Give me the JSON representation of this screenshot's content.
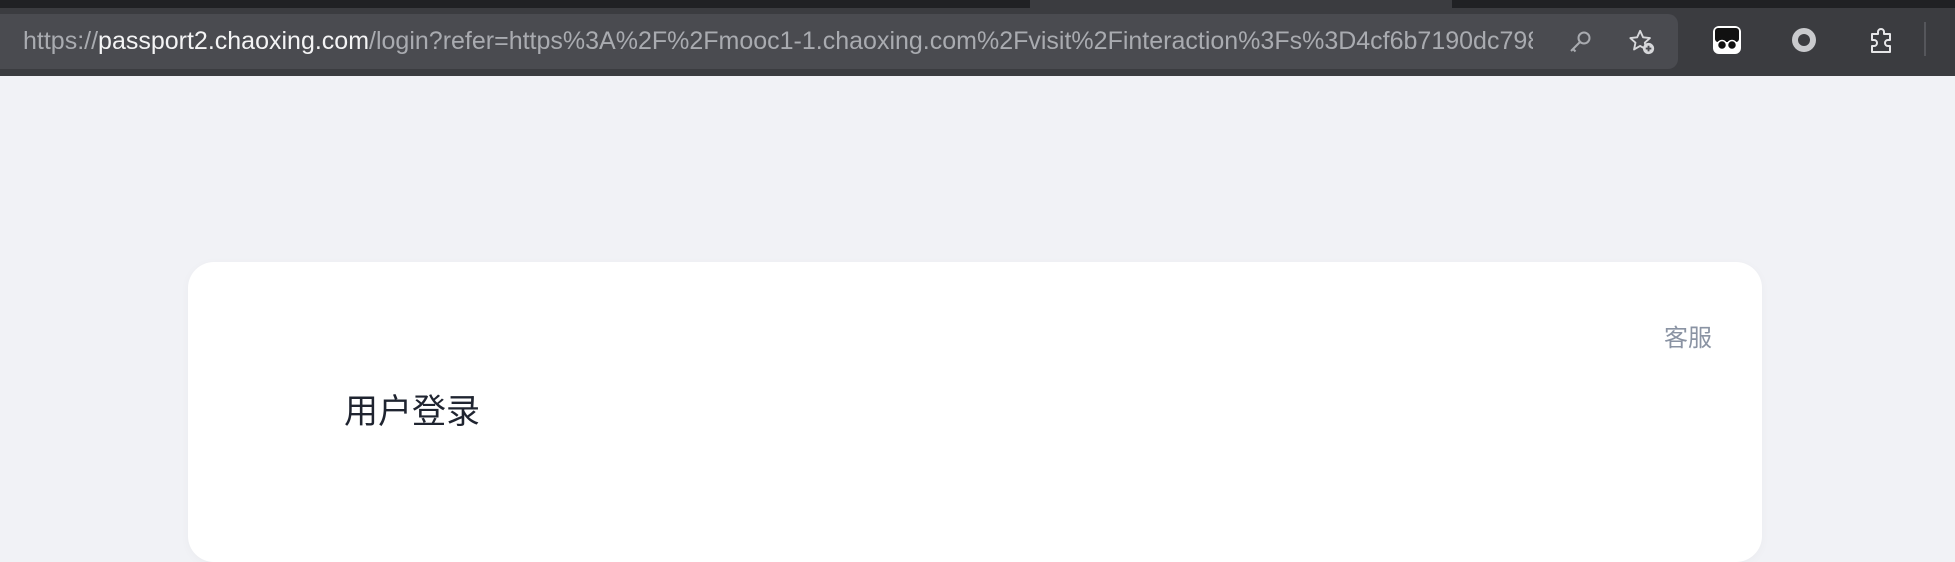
{
  "browser": {
    "address_bar": {
      "url_scheme": "https://",
      "url_host": "passport2.chaoxing.com",
      "url_rest": "/login?refer=https%3A%2F%2Fmooc1-1.chaoxing.com%2Fvisit%2Finteraction%3Fs%3D4cf6b7190dc7982e..."
    },
    "icons": [
      "key-icon",
      "add-favorite-icon",
      "extension-glasses-icon",
      "extension-circle-icon",
      "extensions-puzzle-icon"
    ]
  },
  "login_card": {
    "service_label": "客服",
    "title": "用户登录"
  }
}
